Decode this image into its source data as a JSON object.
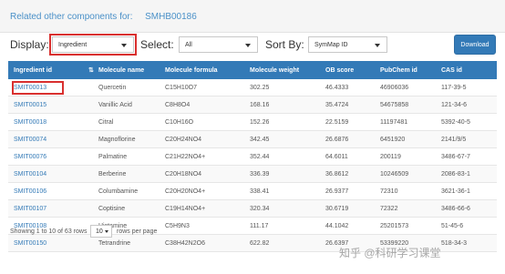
{
  "header": {
    "title": "Related other components for:",
    "code": "SMHB00186"
  },
  "controls": {
    "display_label": "Display:",
    "display_value": "Ingredient",
    "select_label": "Select:",
    "select_value": "All",
    "sortby_label": "Sort By:",
    "sortby_value": "SymMap ID",
    "download_label": "Download"
  },
  "table": {
    "headers": [
      "Ingredient id",
      "Molecule name",
      "Molecule formula",
      "Molecule weight",
      "OB score",
      "PubChem id",
      "CAS id"
    ],
    "rows": [
      [
        "SMIT00013",
        "Quercetin",
        "C15H10O7",
        "302.25",
        "46.4333",
        "46906036",
        "117-39-5"
      ],
      [
        "SMIT00015",
        "Vanillic Acid",
        "C8H8O4",
        "168.16",
        "35.4724",
        "54675858",
        "121-34-6"
      ],
      [
        "SMIT00018",
        "Citral",
        "C10H16O",
        "152.26",
        "22.5159",
        "11197481",
        "5392-40-5"
      ],
      [
        "SMIT00074",
        "Magnoflorine",
        "C20H24NO4",
        "342.45",
        "26.6876",
        "6451920",
        "2141/9/5"
      ],
      [
        "SMIT00076",
        "Palmatine",
        "C21H22NO4+",
        "352.44",
        "64.6011",
        "200119",
        "3486-67-7"
      ],
      [
        "SMIT00104",
        "Berberine",
        "C20H18NO4",
        "336.39",
        "36.8612",
        "10246509",
        "2086-83-1"
      ],
      [
        "SMIT00106",
        "Columbamine",
        "C20H20NO4+",
        "338.41",
        "26.9377",
        "72310",
        "3621-36-1"
      ],
      [
        "SMIT00107",
        "Coptisine",
        "C19H14NO4+",
        "320.34",
        "30.6719",
        "72322",
        "3486-66-6"
      ],
      [
        "SMIT00108",
        "Histamine",
        "C5H9N3",
        "111.17",
        "44.1042",
        "25201573",
        "51-45-6"
      ],
      [
        "SMIT00150",
        "Tetrandrine",
        "C38H42N2O6",
        "622.82",
        "26.6397",
        "53399220",
        "518-34-3"
      ]
    ]
  },
  "footer": {
    "showing": "Showing 1 to 10 of 63 rows",
    "page_size": "10",
    "rows_per_page": "rows per page"
  },
  "watermark": "知乎 @科研学习课堂",
  "colors": {
    "header_bg": "#337ab7",
    "link": "#337ab7",
    "highlight": "#d9302f"
  }
}
